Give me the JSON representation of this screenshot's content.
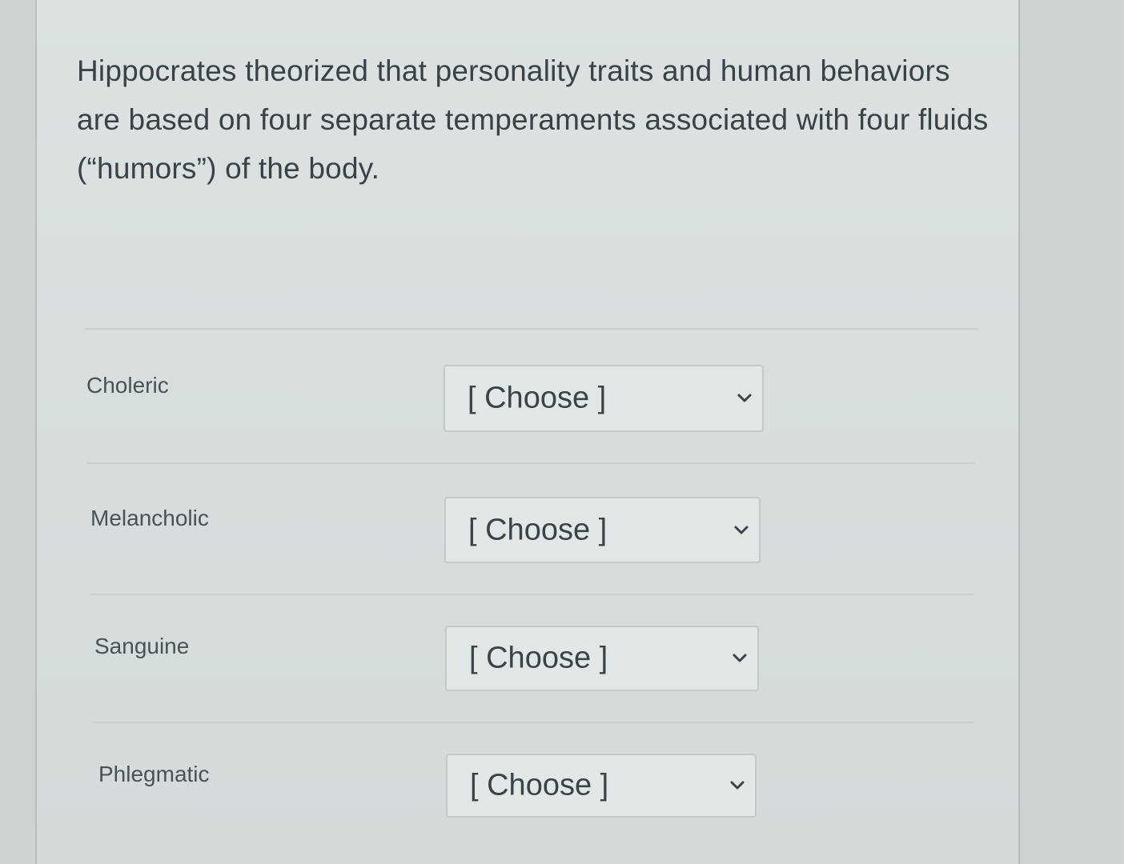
{
  "question": {
    "text": "Hippocrates theorized that personality traits and human behaviors are based on four separate temperaments associated with four fluids (“humors”) of the body."
  },
  "matches": [
    {
      "label": "Choleric",
      "selected": "[ Choose ]",
      "icon": "chevron-down-icon"
    },
    {
      "label": "Melancholic",
      "selected": "[ Choose ]",
      "icon": "chevron-down-icon"
    },
    {
      "label": "Sanguine",
      "selected": "[ Choose ]",
      "icon": "chevron-down-icon"
    },
    {
      "label": "Phlegmatic",
      "selected": "[ Choose ]",
      "icon": "chevron-down-icon"
    }
  ],
  "colors": {
    "text": "#3a4147",
    "panel": "#dde2e1",
    "select_bg": "#e2e6e5",
    "border": "#c3c9c8"
  }
}
